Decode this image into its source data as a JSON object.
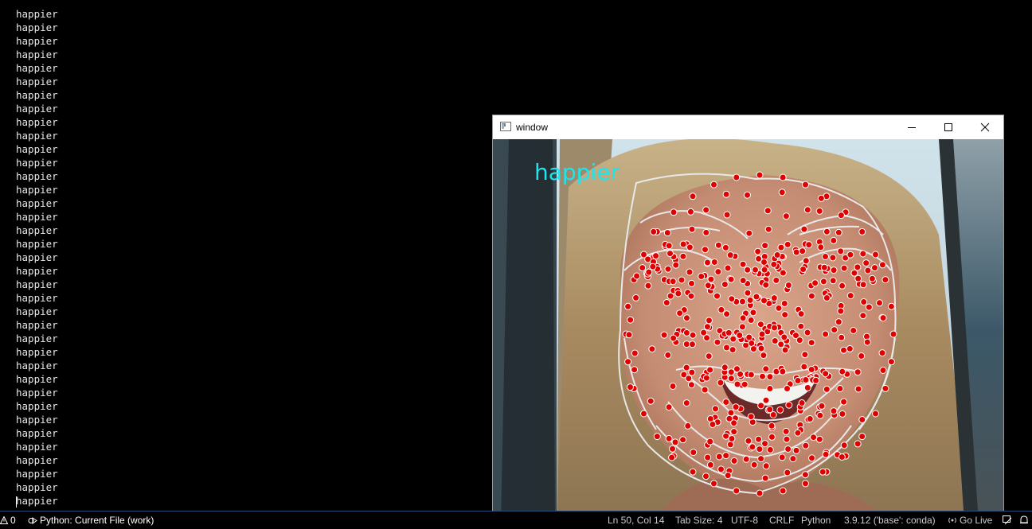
{
  "terminal": {
    "lines": [
      "happier",
      "happier",
      "happier",
      "happier",
      "happier",
      "happier",
      "happier",
      "happier",
      "happier",
      "happier",
      "happier",
      "happier",
      "happier",
      "happier",
      "happier",
      "happier",
      "happier",
      "happier",
      "happier",
      "happier",
      "happier",
      "happier",
      "happier",
      "happier",
      "happier",
      "happier",
      "happier",
      "happier",
      "happier",
      "happier",
      "happier",
      "happier",
      "happier",
      "happier",
      "happier",
      "happier",
      "happier"
    ]
  },
  "window": {
    "title": "window",
    "overlay_label": "happier",
    "overlay_color": "#19e6f0",
    "landmark_color": "#e00000",
    "mesh_color": "#e8e8e8",
    "controls": [
      "minimize-icon",
      "maximize-icon",
      "close-icon"
    ]
  },
  "statusbar": {
    "problems_count": "0",
    "run_config": "Python: Current File (work)",
    "cursor_position": "Ln 50, Col 14",
    "indent": "Tab Size: 4",
    "encoding": "UTF-8",
    "eol": "CRLF",
    "language": "Python",
    "interpreter": "3.9.12 ('base': conda)",
    "go_live": "Go Live"
  }
}
